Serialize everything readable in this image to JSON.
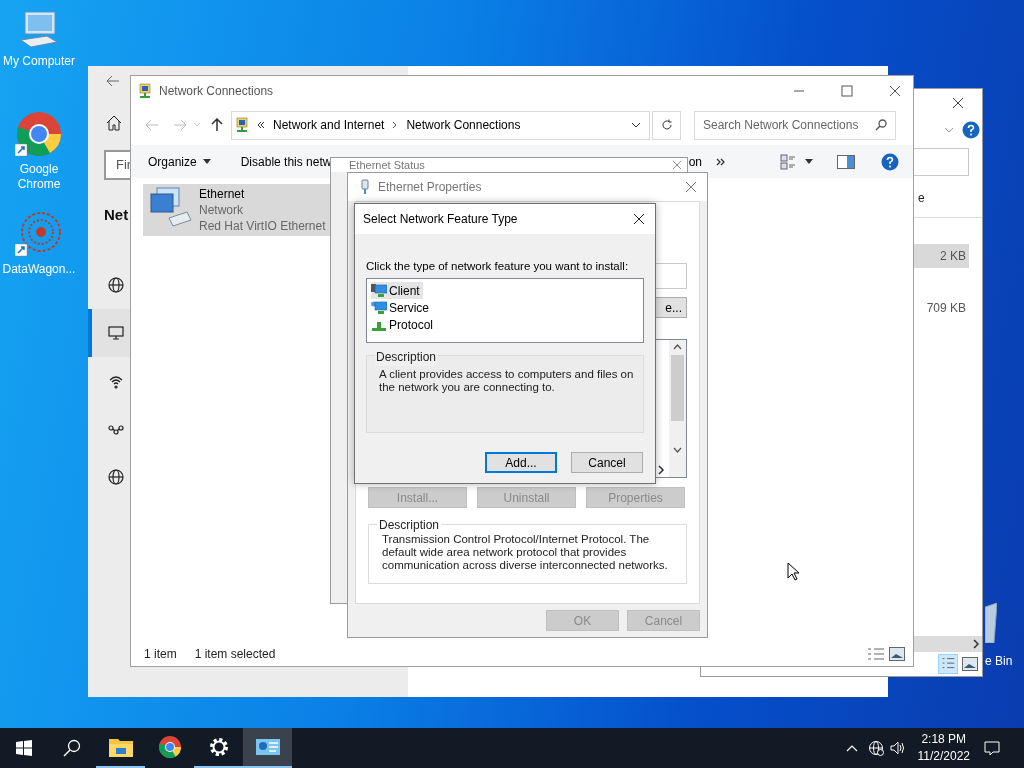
{
  "desktop_icons": [
    {
      "label": "My Computer",
      "kind": "computer"
    },
    {
      "label": "Google Chrome",
      "kind": "chrome"
    },
    {
      "label": "DataWagon...",
      "kind": "datawagon"
    }
  ],
  "recycle_bin": {
    "label": "e Bin"
  },
  "settings_window": {
    "search_placeholder": "Fir",
    "heading": "Net",
    "nav": [
      {
        "kind": "globe",
        "selected": false
      },
      {
        "kind": "ethernet",
        "selected": true
      },
      {
        "kind": "dialup",
        "selected": false
      },
      {
        "kind": "vpn",
        "selected": false
      },
      {
        "kind": "globe",
        "selected": false
      }
    ]
  },
  "explorer_window": {
    "button_fragment": "e",
    "rows": [
      {
        "size": "2 KB",
        "selected": true
      },
      {
        "size": "709 KB",
        "selected": false
      }
    ]
  },
  "network_window": {
    "title": "Network Connections",
    "breadcrumb": [
      "Network and Internet",
      "Network Connections"
    ],
    "search_placeholder": "Search Network Connections",
    "toolbar": [
      {
        "label": "Organize",
        "kind": "menu"
      },
      {
        "label": "Disable this netw",
        "kind": "command"
      },
      {
        "label": "on",
        "kind": "command"
      }
    ],
    "connection": {
      "name": "Ethernet",
      "network": "Network",
      "adapter": "Red Hat VirtIO Ethernet",
      "selected": true
    },
    "status": [
      "1 item",
      "1 item selected"
    ]
  },
  "status_dialog": {
    "title": "Ethernet Status"
  },
  "properties_dialog": {
    "title": "Ethernet Properties",
    "button_fragment": "e...",
    "buttons": [
      {
        "label": "Install...",
        "disabled": true
      },
      {
        "label": "Uninstall",
        "disabled": true
      },
      {
        "label": "Properties",
        "disabled": true
      }
    ],
    "description_label": "Description",
    "description": "Transmission Control Protocol/Internet Protocol. The default wide area network protocol that provides communication across diverse interconnected networks.",
    "footer_buttons": [
      {
        "label": "OK",
        "disabled": true
      },
      {
        "label": "Cancel",
        "disabled": true
      }
    ]
  },
  "feature_dialog": {
    "title": "Select Network Feature Type",
    "prompt": "Click the type of network feature you want to install:",
    "features": [
      {
        "label": "Client",
        "kind": "client",
        "selected": true
      },
      {
        "label": "Service",
        "kind": "service",
        "selected": false
      },
      {
        "label": "Protocol",
        "kind": "protocol",
        "selected": false
      }
    ],
    "description_label": "Description",
    "description": "A client provides access to computers and files on the network you are connecting to.",
    "buttons": [
      {
        "label": "Add...",
        "focused": true
      },
      {
        "label": "Cancel",
        "focused": false
      }
    ]
  },
  "taskbar": {
    "apps": [
      {
        "kind": "explorer",
        "running": true,
        "active": false
      },
      {
        "kind": "chrome",
        "running": false,
        "active": false
      },
      {
        "kind": "settings",
        "running": true,
        "active": false
      },
      {
        "kind": "control_panel",
        "running": true,
        "active": true
      }
    ],
    "time": "2:18 PM",
    "date": "11/2/2022"
  }
}
